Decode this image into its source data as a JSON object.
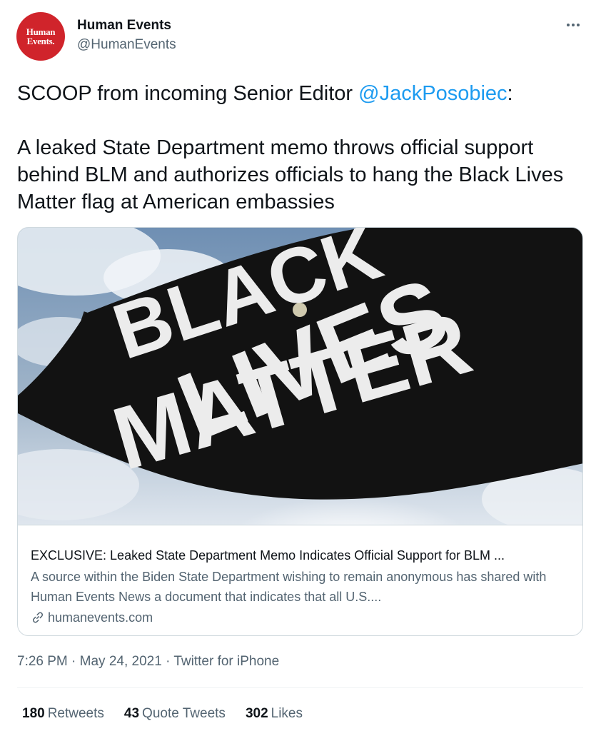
{
  "author": {
    "avatar_line1": "Human",
    "avatar_line2": "Events.",
    "display_name": "Human Events",
    "handle": "@HumanEvents",
    "avatar_color": "#d0242b"
  },
  "tweet": {
    "line1_prefix": "SCOOP from incoming Senior Editor ",
    "mention": "@JackPosobiec",
    "line1_suffix": ":",
    "paragraph2": "A leaked State Department memo throws official support behind BLM and authorizes officials to hang the Black Lives Matter flag at American embassies"
  },
  "card": {
    "image_text": [
      "BLACK",
      "LIVES",
      "MATTER"
    ],
    "title": "EXCLUSIVE: Leaked State Department Memo Indicates Official Support for BLM ...",
    "description": "A source within the Biden State Department wishing to remain anonymous has shared with Human Events News a document that indicates that all U.S....",
    "domain": "humanevents.com",
    "link_icon": "link-icon"
  },
  "meta": {
    "time": "7:26 PM",
    "separator": " · ",
    "date": "May 24, 2021",
    "source": "Twitter for iPhone"
  },
  "stats": {
    "retweets_count": "180",
    "retweets_label": "Retweets",
    "quotes_count": "43",
    "quotes_label": "Quote Tweets",
    "likes_count": "302",
    "likes_label": "Likes"
  },
  "colors": {
    "link_blue": "#1d9bf0",
    "secondary_text": "#536471",
    "border": "#cfd9de"
  },
  "icons": {
    "more": "more-horizontal-icon"
  }
}
